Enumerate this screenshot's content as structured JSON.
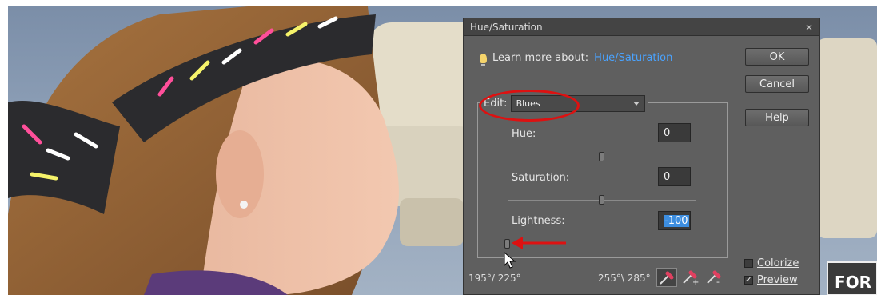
{
  "dialog": {
    "title": "Hue/Saturation",
    "close_glyph": "×",
    "learn_label": "Learn more about:",
    "learn_link": "Hue/Saturation",
    "buttons": {
      "ok": "OK",
      "cancel": "Cancel",
      "help": "Help"
    },
    "edit": {
      "label": "Edit:",
      "selected": "Blues"
    },
    "hue": {
      "label": "Hue:",
      "value": "0"
    },
    "saturation": {
      "label": "Saturation:",
      "value": "0"
    },
    "lightness": {
      "label": "Lightness:",
      "value": "-100"
    },
    "range_left": "195°/ 225°",
    "range_right": "255°\\ 285°",
    "colorize_label": "Colorize",
    "preview_label": "Preview",
    "preview_checked": "✓"
  },
  "photo": {
    "sign_text": "FOR"
  },
  "colors": {
    "accent_link": "#4aa3ff",
    "highlight": "#d11111"
  },
  "icons": [
    "bulb-icon",
    "close-icon",
    "eyedropper-icon",
    "eyedropper-plus-icon",
    "eyedropper-minus-icon",
    "cursor-icon",
    "red-arrow"
  ]
}
